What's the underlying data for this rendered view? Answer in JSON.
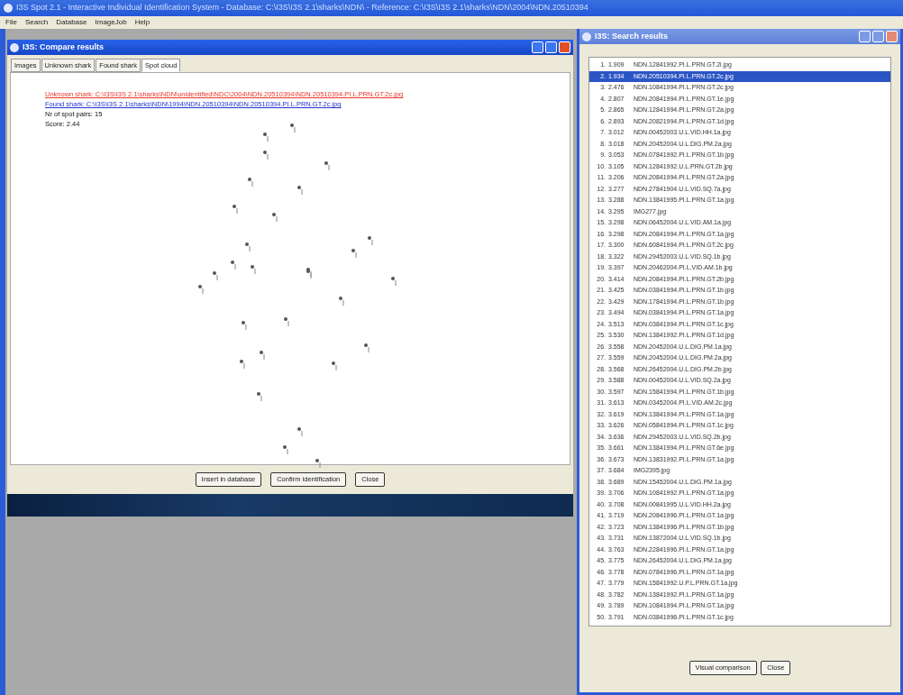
{
  "app": {
    "title": "I3S Spot 2.1 - Interactive Individual Identification System - Database: C:\\I3S\\I3S 2.1\\sharks\\NDN\\ - Reference: C:\\I3S\\I3S 2.1\\sharks\\NDN\\2004\\NDN.20510394",
    "menu": [
      "File",
      "Search",
      "Database",
      "ImageJob",
      "Help"
    ]
  },
  "compare_window": {
    "title": "I3S: Compare results",
    "tabs": [
      {
        "label": "Images",
        "selected": false
      },
      {
        "label": "Unknown shark",
        "selected": false
      },
      {
        "label": "Found shark",
        "selected": false
      },
      {
        "label": "Spot cloud",
        "selected": true
      }
    ],
    "lines": [
      {
        "kind": "unknown",
        "text": "Unknown shark: C:\\I3S\\I3S 2.1\\sharks\\NDN\\unidentified\\NDC\\2004\\NDN.20510394\\NDN.20510394.PI.L.PRN.GT.2c.jpg"
      },
      {
        "kind": "found",
        "text": "Found shark: C:\\I3S\\I3S 2.1\\sharks\\NDN\\1994\\NDN.20510394\\NDN.20510394.PI.L.PRN.GT.2c.jpg"
      },
      {
        "kind": "plain",
        "text": "Nr of spot pairs: 15"
      },
      {
        "kind": "plain",
        "text": "Score: 2.44"
      }
    ],
    "buttons": [
      "Insert in database",
      "Confirm identification",
      "Close"
    ]
  },
  "search_window": {
    "title": "I3S: Search results",
    "results": [
      {
        "rank": "1.",
        "score": "1.909",
        "file": "NDN.12841992.PI.L.PRN.GT.2i.jpg",
        "selected": false
      },
      {
        "rank": "2.",
        "score": "1.934",
        "file": "NDN.20510394.PI.L.PRN.GT.2c.jpg",
        "selected": true
      },
      {
        "rank": "3.",
        "score": "2.476",
        "file": "NDN.10841994.PI.L.PRN.GT.2c.jpg",
        "selected": false
      },
      {
        "rank": "4.",
        "score": "2.807",
        "file": "NDN.20841994.PI.L.PRN.GT.1e.jpg",
        "selected": false
      },
      {
        "rank": "5.",
        "score": "2.865",
        "file": "NDN.12841994.PI.L.PRN.GT.2a.jpg",
        "selected": false
      },
      {
        "rank": "6.",
        "score": "2.893",
        "file": "NDN.20821994.PI.L.PRN.GT.1d.jpg",
        "selected": false
      },
      {
        "rank": "7.",
        "score": "3.012",
        "file": "NDN.00452003.U.L.VID.HH.1a.jpg",
        "selected": false
      },
      {
        "rank": "8.",
        "score": "3.018",
        "file": "NDN.20452004.U.L.DIG.PM.2a.jpg",
        "selected": false
      },
      {
        "rank": "9.",
        "score": "3.053",
        "file": "NDN.07841992.PI.L.PRN.GT.1b.jpg",
        "selected": false
      },
      {
        "rank": "10.",
        "score": "3.105",
        "file": "NDN.12841992.U.L.PRN.GT.2b.jpg",
        "selected": false
      },
      {
        "rank": "11.",
        "score": "3.206",
        "file": "NDN.20841994.PI.L.PRN.GT.2a.jpg",
        "selected": false
      },
      {
        "rank": "12.",
        "score": "3.277",
        "file": "NDN.27841904.U.L.VID.SQ.7a.jpg",
        "selected": false
      },
      {
        "rank": "13.",
        "score": "3.288",
        "file": "NDN.13841995.PI.L.PRN.GT.1a.jpg",
        "selected": false
      },
      {
        "rank": "14.",
        "score": "3.295",
        "file": "IMG277.jpg",
        "selected": false
      },
      {
        "rank": "15.",
        "score": "3.298",
        "file": "NDN.06452004.U.L.VID.AM.1a.jpg",
        "selected": false
      },
      {
        "rank": "16.",
        "score": "3.298",
        "file": "NDN.20841994.PI.L.PRN.GT.1a.jpg",
        "selected": false
      },
      {
        "rank": "17.",
        "score": "3.300",
        "file": "NDN.60841994.PI.L.PRN.GT.2c.jpg",
        "selected": false
      },
      {
        "rank": "18.",
        "score": "3.322",
        "file": "NDN.29452003.U.L.VID.SQ.1b.jpg",
        "selected": false
      },
      {
        "rank": "19.",
        "score": "3.397",
        "file": "NDN.20462004.PI.L.VID.AM.1b.jpg",
        "selected": false
      },
      {
        "rank": "20.",
        "score": "3.414",
        "file": "NDN.20841994.PI.L.PRN.GT.2b.jpg",
        "selected": false
      },
      {
        "rank": "21.",
        "score": "3.425",
        "file": "NDN.03841994.PI.L.PRN.GT.1b.jpg",
        "selected": false
      },
      {
        "rank": "22.",
        "score": "3.429",
        "file": "NDN.17841994.PI.L.PRN.GT.1b.jpg",
        "selected": false
      },
      {
        "rank": "23.",
        "score": "3.494",
        "file": "NDN.03841994.PI.L.PRN.GT.1a.jpg",
        "selected": false
      },
      {
        "rank": "24.",
        "score": "3.513",
        "file": "NDN.03841994.PI.L.PRN.GT.1c.jpg",
        "selected": false
      },
      {
        "rank": "25.",
        "score": "3.530",
        "file": "NDN.13841992.PI.L.PRN.GT.1d.jpg",
        "selected": false
      },
      {
        "rank": "26.",
        "score": "3.558",
        "file": "NDN.20452004.U.L.DIG.PM.1a.jpg",
        "selected": false
      },
      {
        "rank": "27.",
        "score": "3.559",
        "file": "NDN.20452004.U.L.DIG.PM.2a.jpg",
        "selected": false
      },
      {
        "rank": "28.",
        "score": "3.568",
        "file": "NDN.26452004.U.L.DIG.PM.2b.jpg",
        "selected": false
      },
      {
        "rank": "29.",
        "score": "3.588",
        "file": "NDN.00452004.U.L.VID.SQ.2a.jpg",
        "selected": false
      },
      {
        "rank": "30.",
        "score": "3.597",
        "file": "NDN.15841994.PI.L.PRN.GT.1b.jpg",
        "selected": false
      },
      {
        "rank": "31.",
        "score": "3.613",
        "file": "NDN.03452004.PI.L.VID.AM.2c.jpg",
        "selected": false
      },
      {
        "rank": "32.",
        "score": "3.619",
        "file": "NDN.13841994.PI.L.PRN.GT.1a.jpg",
        "selected": false
      },
      {
        "rank": "33.",
        "score": "3.626",
        "file": "NDN.05841994.PI.L.PRN.GT.1c.jpg",
        "selected": false
      },
      {
        "rank": "34.",
        "score": "3.636",
        "file": "NDN.29452003.U.L.VID.SQ.2b.jpg",
        "selected": false
      },
      {
        "rank": "35.",
        "score": "3.661",
        "file": "NDN.13841994.PI.L.PRN.GT.6e.jpg",
        "selected": false
      },
      {
        "rank": "36.",
        "score": "3.673",
        "file": "NDN.13831992.PI.L.PRN.GT.1a.jpg",
        "selected": false
      },
      {
        "rank": "37.",
        "score": "3.684",
        "file": "IMG2395.jpg",
        "selected": false
      },
      {
        "rank": "38.",
        "score": "3.689",
        "file": "NDN.15452004.U.L.DIG.PM.1a.jpg",
        "selected": false
      },
      {
        "rank": "39.",
        "score": "3.706",
        "file": "NDN.10841992.PI.L.PRN.GT.1a.jpg",
        "selected": false
      },
      {
        "rank": "40.",
        "score": "3.708",
        "file": "NDN.00841995.U.L.VID.HH.2a.jpg",
        "selected": false
      },
      {
        "rank": "41.",
        "score": "3.719",
        "file": "NDN.20841996.PI.L.PRN.GT.1a.jpg",
        "selected": false
      },
      {
        "rank": "42.",
        "score": "3.723",
        "file": "NDN.13841996.PI.L.PRN.GT.1b.jpg",
        "selected": false
      },
      {
        "rank": "43.",
        "score": "3.731",
        "file": "NDN.13872004.U.L.VID.SQ.1b.jpg",
        "selected": false
      },
      {
        "rank": "44.",
        "score": "3.763",
        "file": "NDN.22841996.PI.L.PRN.GT.1a.jpg",
        "selected": false
      },
      {
        "rank": "45.",
        "score": "3.775",
        "file": "NDN.26452004.U.L.DIG.PM.1a.jpg",
        "selected": false
      },
      {
        "rank": "46.",
        "score": "3.778",
        "file": "NDN.07841996.PI.L.PRN.GT.1a.jpg",
        "selected": false
      },
      {
        "rank": "47.",
        "score": "3.779",
        "file": "NDN.15841992.U.P.L.PRN.GT.1a.jpg",
        "selected": false
      },
      {
        "rank": "48.",
        "score": "3.782",
        "file": "NDN.13841992.PI.L.PRN.GT.1a.jpg",
        "selected": false
      },
      {
        "rank": "49.",
        "score": "3.789",
        "file": "NDN.10841994.PI.L.PRN.GT.1a.jpg",
        "selected": false
      },
      {
        "rank": "50.",
        "score": "3.791",
        "file": "NDN.03841996.PI.L.PRN.GT.1c.jpg",
        "selected": false
      }
    ],
    "buttons": [
      "Visual comparison",
      "Close"
    ]
  }
}
